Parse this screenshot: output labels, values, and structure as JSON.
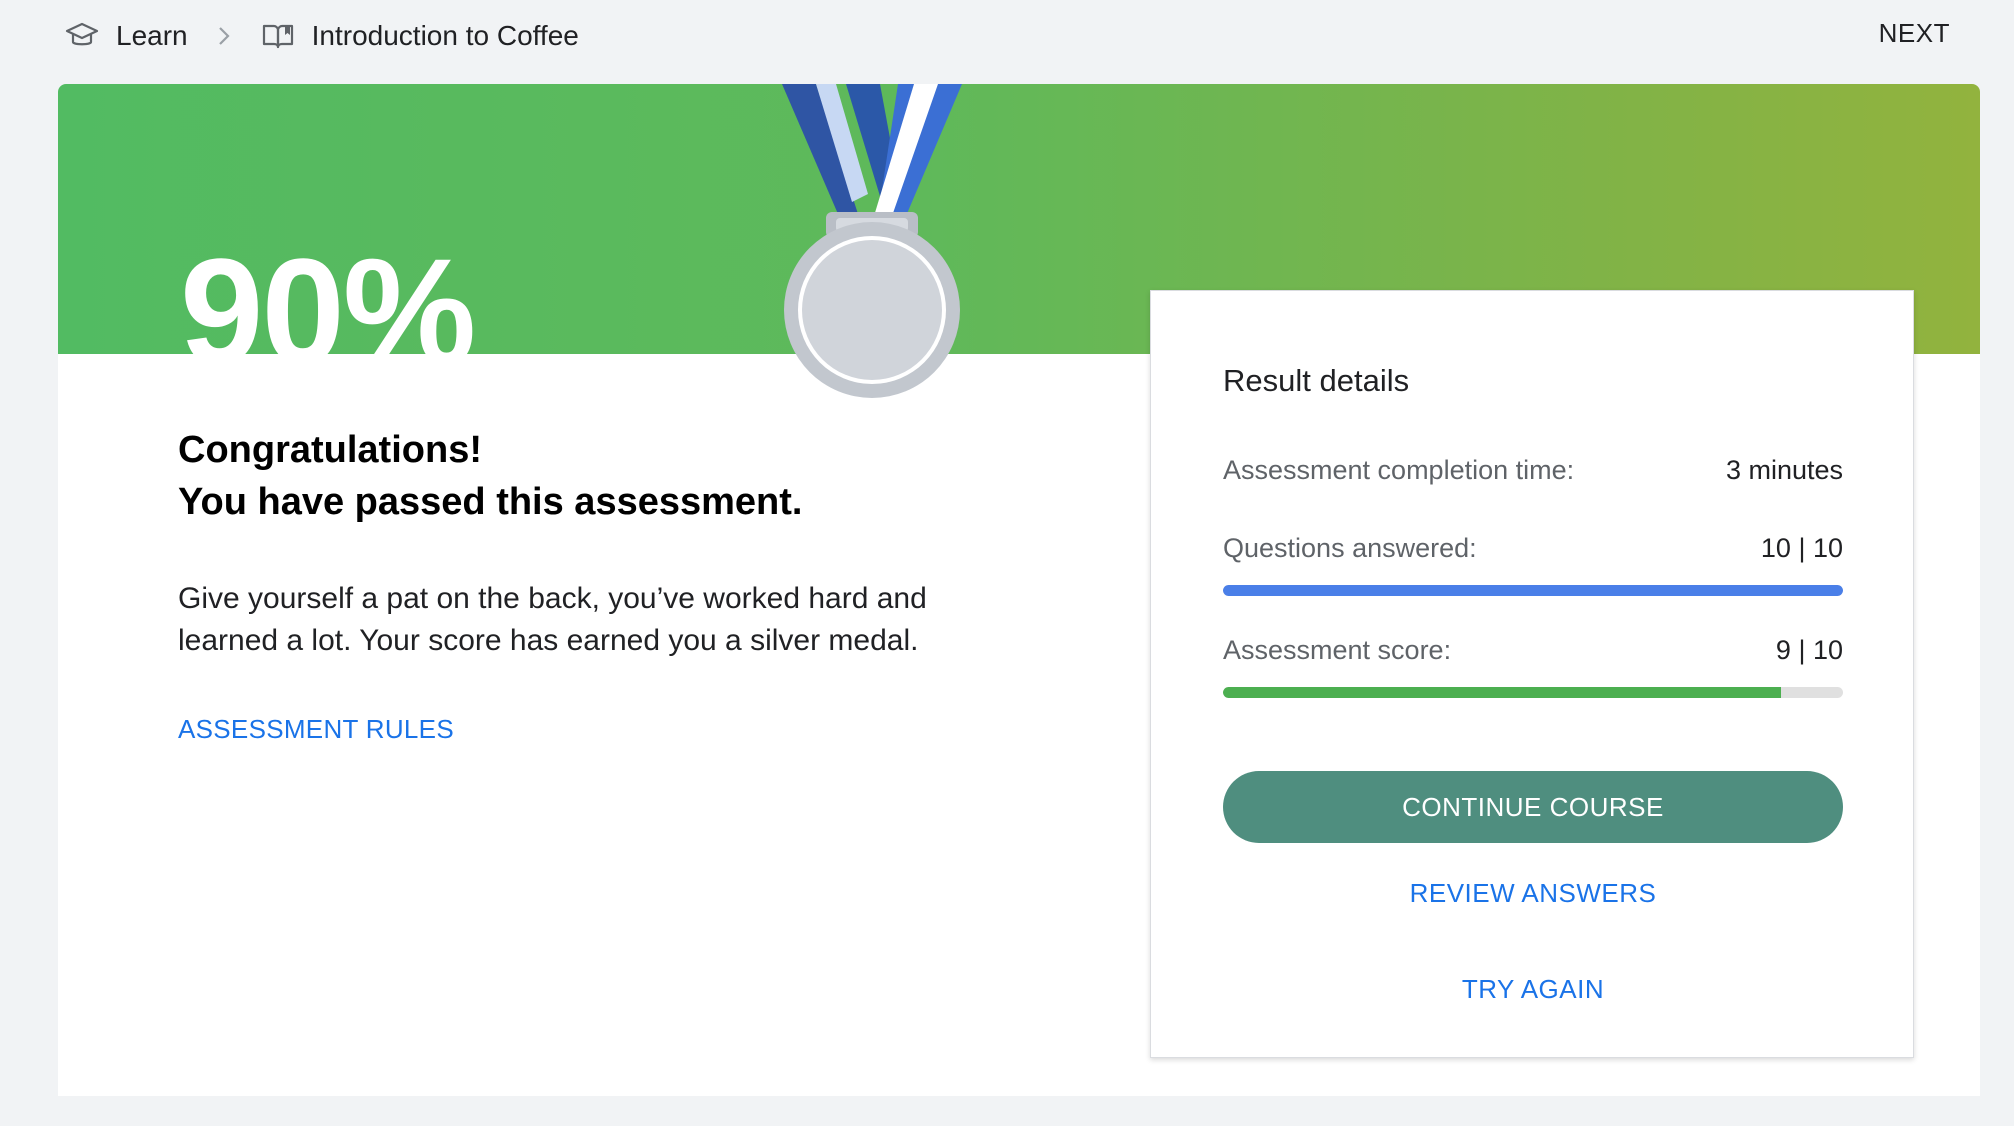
{
  "breadcrumb": {
    "items": [
      {
        "label": "Learn",
        "icon": "graduation-cap-icon"
      },
      {
        "label": "Introduction to Coffee",
        "icon": "open-book-icon"
      }
    ],
    "separator_icon": "chevron-right-icon"
  },
  "header": {
    "next_label": "NEXT"
  },
  "banner": {
    "percent": "90%",
    "medal": "silver-medal-icon"
  },
  "progress": {
    "score_percent": 90
  },
  "message": {
    "line1": "Congratulations!",
    "line2": "You have passed this assessment.",
    "body": "Give yourself a pat on the back, you’ve worked hard and learned a lot. Your score has earned you a silver medal.",
    "rules_link": "ASSESSMENT RULES"
  },
  "results": {
    "title": "Result details",
    "completion_time_label": "Assessment completion time:",
    "completion_time_value": "3 minutes",
    "questions_label": "Questions answered:",
    "questions_value": "10 | 10",
    "questions_progress": 1.0,
    "score_label": "Assessment score:",
    "score_value": "9 | 10",
    "score_progress": 0.9,
    "continue_label": "CONTINUE COURSE",
    "review_label": "REVIEW ANSWERS",
    "try_again_label": "TRY AGAIN"
  },
  "colors": {
    "accent_blue": "#1a73e8",
    "progress_blue": "#4a7fe8",
    "progress_green": "#4caf50",
    "button_teal": "#4f8e7f",
    "banner_green": "#5fb95a"
  }
}
